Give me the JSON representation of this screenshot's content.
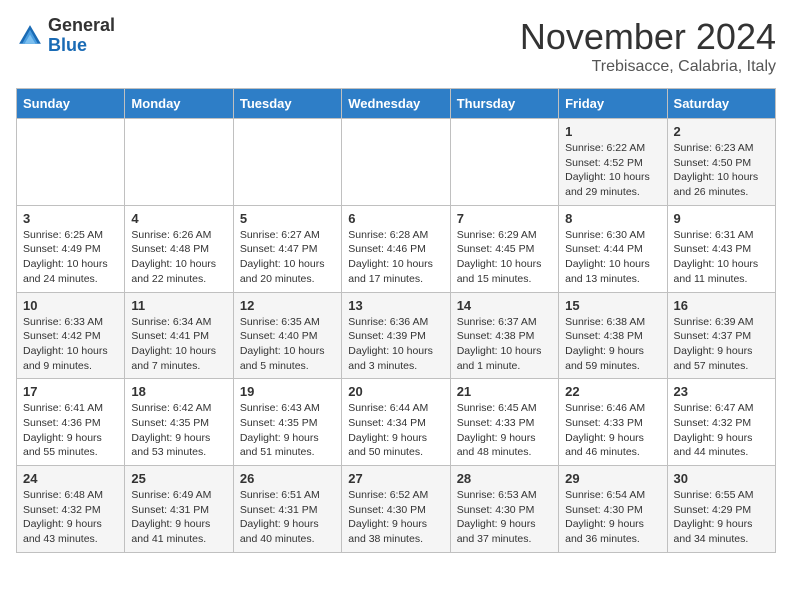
{
  "logo": {
    "general": "General",
    "blue": "Blue"
  },
  "header": {
    "month": "November 2024",
    "location": "Trebisacce, Calabria, Italy"
  },
  "days_of_week": [
    "Sunday",
    "Monday",
    "Tuesday",
    "Wednesday",
    "Thursday",
    "Friday",
    "Saturday"
  ],
  "weeks": [
    [
      {
        "day": "",
        "info": ""
      },
      {
        "day": "",
        "info": ""
      },
      {
        "day": "",
        "info": ""
      },
      {
        "day": "",
        "info": ""
      },
      {
        "day": "",
        "info": ""
      },
      {
        "day": "1",
        "info": "Sunrise: 6:22 AM\nSunset: 4:52 PM\nDaylight: 10 hours and 29 minutes."
      },
      {
        "day": "2",
        "info": "Sunrise: 6:23 AM\nSunset: 4:50 PM\nDaylight: 10 hours and 26 minutes."
      }
    ],
    [
      {
        "day": "3",
        "info": "Sunrise: 6:25 AM\nSunset: 4:49 PM\nDaylight: 10 hours and 24 minutes."
      },
      {
        "day": "4",
        "info": "Sunrise: 6:26 AM\nSunset: 4:48 PM\nDaylight: 10 hours and 22 minutes."
      },
      {
        "day": "5",
        "info": "Sunrise: 6:27 AM\nSunset: 4:47 PM\nDaylight: 10 hours and 20 minutes."
      },
      {
        "day": "6",
        "info": "Sunrise: 6:28 AM\nSunset: 4:46 PM\nDaylight: 10 hours and 17 minutes."
      },
      {
        "day": "7",
        "info": "Sunrise: 6:29 AM\nSunset: 4:45 PM\nDaylight: 10 hours and 15 minutes."
      },
      {
        "day": "8",
        "info": "Sunrise: 6:30 AM\nSunset: 4:44 PM\nDaylight: 10 hours and 13 minutes."
      },
      {
        "day": "9",
        "info": "Sunrise: 6:31 AM\nSunset: 4:43 PM\nDaylight: 10 hours and 11 minutes."
      }
    ],
    [
      {
        "day": "10",
        "info": "Sunrise: 6:33 AM\nSunset: 4:42 PM\nDaylight: 10 hours and 9 minutes."
      },
      {
        "day": "11",
        "info": "Sunrise: 6:34 AM\nSunset: 4:41 PM\nDaylight: 10 hours and 7 minutes."
      },
      {
        "day": "12",
        "info": "Sunrise: 6:35 AM\nSunset: 4:40 PM\nDaylight: 10 hours and 5 minutes."
      },
      {
        "day": "13",
        "info": "Sunrise: 6:36 AM\nSunset: 4:39 PM\nDaylight: 10 hours and 3 minutes."
      },
      {
        "day": "14",
        "info": "Sunrise: 6:37 AM\nSunset: 4:38 PM\nDaylight: 10 hours and 1 minute."
      },
      {
        "day": "15",
        "info": "Sunrise: 6:38 AM\nSunset: 4:38 PM\nDaylight: 9 hours and 59 minutes."
      },
      {
        "day": "16",
        "info": "Sunrise: 6:39 AM\nSunset: 4:37 PM\nDaylight: 9 hours and 57 minutes."
      }
    ],
    [
      {
        "day": "17",
        "info": "Sunrise: 6:41 AM\nSunset: 4:36 PM\nDaylight: 9 hours and 55 minutes."
      },
      {
        "day": "18",
        "info": "Sunrise: 6:42 AM\nSunset: 4:35 PM\nDaylight: 9 hours and 53 minutes."
      },
      {
        "day": "19",
        "info": "Sunrise: 6:43 AM\nSunset: 4:35 PM\nDaylight: 9 hours and 51 minutes."
      },
      {
        "day": "20",
        "info": "Sunrise: 6:44 AM\nSunset: 4:34 PM\nDaylight: 9 hours and 50 minutes."
      },
      {
        "day": "21",
        "info": "Sunrise: 6:45 AM\nSunset: 4:33 PM\nDaylight: 9 hours and 48 minutes."
      },
      {
        "day": "22",
        "info": "Sunrise: 6:46 AM\nSunset: 4:33 PM\nDaylight: 9 hours and 46 minutes."
      },
      {
        "day": "23",
        "info": "Sunrise: 6:47 AM\nSunset: 4:32 PM\nDaylight: 9 hours and 44 minutes."
      }
    ],
    [
      {
        "day": "24",
        "info": "Sunrise: 6:48 AM\nSunset: 4:32 PM\nDaylight: 9 hours and 43 minutes."
      },
      {
        "day": "25",
        "info": "Sunrise: 6:49 AM\nSunset: 4:31 PM\nDaylight: 9 hours and 41 minutes."
      },
      {
        "day": "26",
        "info": "Sunrise: 6:51 AM\nSunset: 4:31 PM\nDaylight: 9 hours and 40 minutes."
      },
      {
        "day": "27",
        "info": "Sunrise: 6:52 AM\nSunset: 4:30 PM\nDaylight: 9 hours and 38 minutes."
      },
      {
        "day": "28",
        "info": "Sunrise: 6:53 AM\nSunset: 4:30 PM\nDaylight: 9 hours and 37 minutes."
      },
      {
        "day": "29",
        "info": "Sunrise: 6:54 AM\nSunset: 4:30 PM\nDaylight: 9 hours and 36 minutes."
      },
      {
        "day": "30",
        "info": "Sunrise: 6:55 AM\nSunset: 4:29 PM\nDaylight: 9 hours and 34 minutes."
      }
    ]
  ]
}
